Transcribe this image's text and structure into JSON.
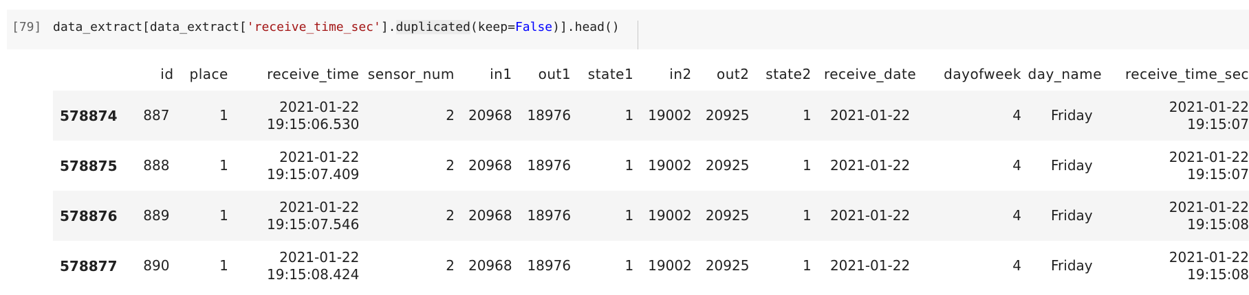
{
  "cell": {
    "execution_count": "[79]",
    "code": {
      "part1": "data_extract[data_extract[",
      "string": "'receive_time_sec'",
      "part2": "].",
      "method": "duplicated",
      "part3": "(keep=",
      "keyword": "False",
      "part4": ")].head()"
    }
  },
  "output": {
    "columns": [
      "",
      "id",
      "place",
      "receive_time",
      "sensor_num",
      "in1",
      "out1",
      "state1",
      "in2",
      "out2",
      "state2",
      "receive_date",
      "dayofweek",
      "day_name",
      "receive_time_sec"
    ],
    "rows": [
      {
        "index": "578874",
        "id": "887",
        "place": "1",
        "receive_time_date": "2021-01-22",
        "receive_time_time": "19:15:06.530",
        "sensor_num": "2",
        "in1": "20968",
        "out1": "18976",
        "state1": "1",
        "in2": "19002",
        "out2": "20925",
        "state2": "1",
        "receive_date": "2021-01-22",
        "dayofweek": "4",
        "day_name": "Friday",
        "receive_time_sec_date": "2021-01-22",
        "receive_time_sec_time": "19:15:07"
      },
      {
        "index": "578875",
        "id": "888",
        "place": "1",
        "receive_time_date": "2021-01-22",
        "receive_time_time": "19:15:07.409",
        "sensor_num": "2",
        "in1": "20968",
        "out1": "18976",
        "state1": "1",
        "in2": "19002",
        "out2": "20925",
        "state2": "1",
        "receive_date": "2021-01-22",
        "dayofweek": "4",
        "day_name": "Friday",
        "receive_time_sec_date": "2021-01-22",
        "receive_time_sec_time": "19:15:07"
      },
      {
        "index": "578876",
        "id": "889",
        "place": "1",
        "receive_time_date": "2021-01-22",
        "receive_time_time": "19:15:07.546",
        "sensor_num": "2",
        "in1": "20968",
        "out1": "18976",
        "state1": "1",
        "in2": "19002",
        "out2": "20925",
        "state2": "1",
        "receive_date": "2021-01-22",
        "dayofweek": "4",
        "day_name": "Friday",
        "receive_time_sec_date": "2021-01-22",
        "receive_time_sec_time": "19:15:08"
      },
      {
        "index": "578877",
        "id": "890",
        "place": "1",
        "receive_time_date": "2021-01-22",
        "receive_time_time": "19:15:08.424",
        "sensor_num": "2",
        "in1": "20968",
        "out1": "18976",
        "state1": "1",
        "in2": "19002",
        "out2": "20925",
        "state2": "1",
        "receive_date": "2021-01-22",
        "dayofweek": "4",
        "day_name": "Friday",
        "receive_time_sec_date": "2021-01-22",
        "receive_time_sec_time": "19:15:08"
      }
    ]
  },
  "colors": {
    "cell_background": "#f7f7f7",
    "row_stripe": "#f5f5f5",
    "string_token": "#a31515",
    "keyword_token": "#0000ff"
  }
}
